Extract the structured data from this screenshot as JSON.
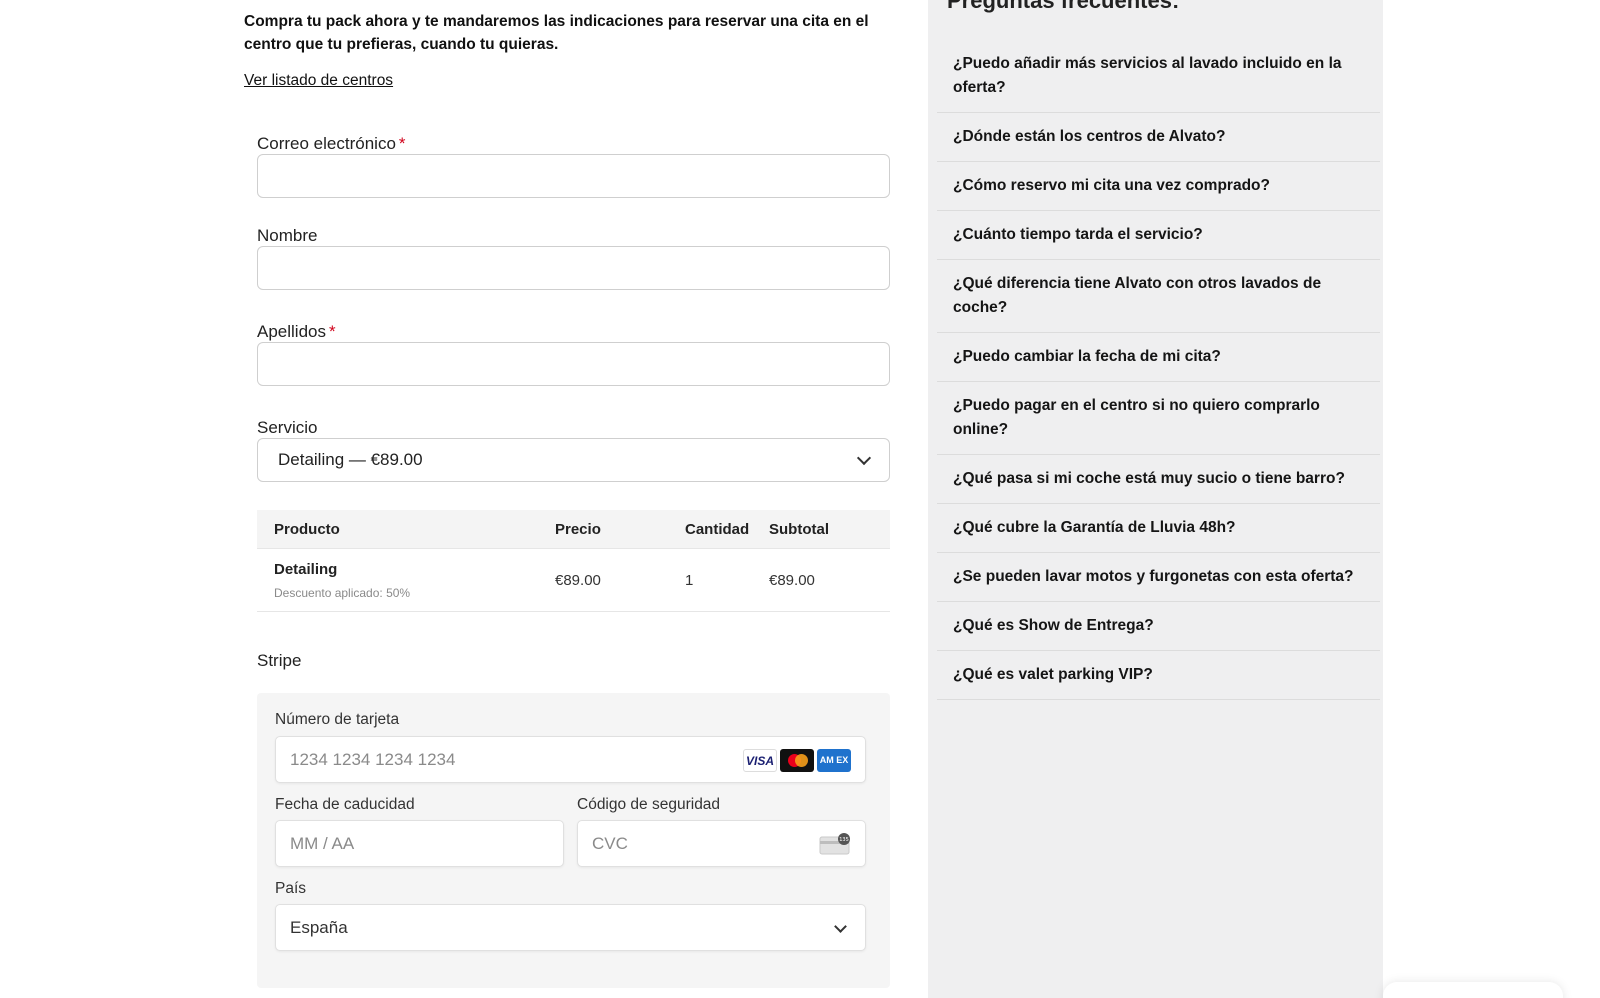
{
  "intro": {
    "text": "Compra tu pack ahora y te mandaremos las indicaciones para reservar una cita en el centro que tu prefieras, cuando tu quieras.",
    "centers_link": "Ver listado de centros"
  },
  "form": {
    "email_label": "Correo electrónico",
    "email_value": "",
    "nombre_label": "Nombre",
    "nombre_value": "",
    "apellidos_label": "Apellidos",
    "apellidos_value": "",
    "required_mark": "*",
    "servicio_label": "Servicio",
    "servicio_selected": "Detailing — €89.00"
  },
  "product_table": {
    "headers": [
      "Producto",
      "Precio",
      "Cantidad",
      "Subtotal"
    ],
    "rows": [
      {
        "product": "Detailing",
        "discount": "Descuento aplicado: 50%",
        "price": "€89.00",
        "quantity": "1",
        "subtotal": "€89.00"
      }
    ]
  },
  "stripe": {
    "title": "Stripe",
    "card_number_label": "Número de tarjeta",
    "card_number_placeholder": "1234 1234 1234 1234",
    "expiry_label": "Fecha de caducidad",
    "expiry_placeholder": "MM / AA",
    "cvc_label": "Código de seguridad",
    "cvc_placeholder": "CVC",
    "cvc_icon_text": "135",
    "country_label": "País",
    "country_selected": "España",
    "brands": [
      {
        "name": "visa-icon",
        "label": "VISA"
      },
      {
        "name": "mastercard-icon",
        "label": ""
      },
      {
        "name": "amex-icon",
        "label": "AM EX"
      }
    ]
  },
  "faq": {
    "title": "Preguntas frecuentes:",
    "items": [
      "¿Puedo añadir más servicios al lavado incluido en la oferta?",
      "¿Dónde están los centros de Alvato?",
      "¿Cómo reservo mi cita una vez comprado?",
      "¿Cuánto tiempo tarda el servicio?",
      "¿Qué diferencia tiene Alvato con otros lavados de coche?",
      "¿Puedo cambiar la fecha de mi cita?",
      "¿Puedo pagar en el centro si no quiero comprarlo online?",
      "¿Qué pasa si mi coche está muy sucio o tiene barro?",
      "¿Qué cubre la Garantía de Lluvia 48h?",
      "¿Se pueden lavar motos y furgonetas con esta oferta?",
      "¿Qué es Show de Entrega?",
      "¿Qué es valet parking VIP?"
    ]
  },
  "colors": {
    "required": "#d0021b",
    "faq_bg": "#efeff0",
    "stripe_bg": "#f5f5f5"
  }
}
